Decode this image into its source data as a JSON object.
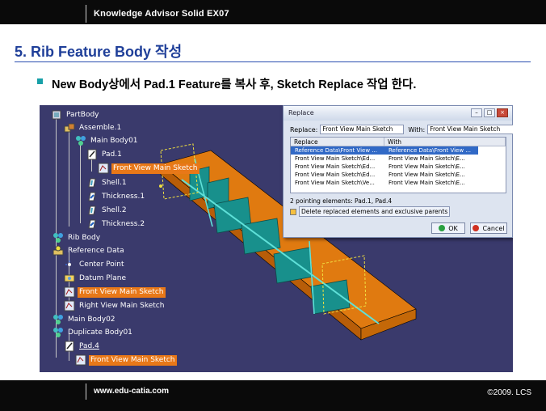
{
  "header": {
    "course": "Knowledge Advisor Solid EX07"
  },
  "slide": {
    "title": "5. Rib Feature Body 작성",
    "bullet": "New Body상에서 Pad.1 Feature를 복사 후,  Sketch Replace 작업 한다."
  },
  "tree": {
    "items": [
      {
        "label": "PartBody",
        "icon": "partbody-icon"
      },
      {
        "label": "Assemble.1",
        "icon": "assemble-icon"
      },
      {
        "label": "Main Body01",
        "icon": "body-icon"
      },
      {
        "label": "Pad.1",
        "icon": "pad-icon"
      },
      {
        "label": "Front View Main Sketch",
        "icon": "sketch-icon"
      },
      {
        "label": "Shell.1",
        "icon": "shell-icon"
      },
      {
        "label": "Thickness.1",
        "icon": "thickness-icon"
      },
      {
        "label": "Shell.2",
        "icon": "shell-icon"
      },
      {
        "label": "Thickness.2",
        "icon": "thickness-icon"
      },
      {
        "label": "Rib Body",
        "icon": "body-icon"
      },
      {
        "label": "Reference Data",
        "icon": "geoset-icon"
      },
      {
        "label": "Center Point",
        "icon": "point-icon"
      },
      {
        "label": "Datum Plane",
        "icon": "plane-icon"
      },
      {
        "label": "Front View Main Sketch",
        "icon": "sketch-icon"
      },
      {
        "label": "Right View Main Sketch",
        "icon": "sketch-icon"
      },
      {
        "label": "Main Body02",
        "icon": "body-icon"
      },
      {
        "label": "Duplicate Body01",
        "icon": "body-icon"
      },
      {
        "label": "Pad.4",
        "icon": "pad-icon"
      },
      {
        "label": "Front View Main Sketch",
        "icon": "sketch-icon"
      }
    ]
  },
  "dialog": {
    "title": "Replace",
    "replace_label": "Replace:",
    "replace_value": "Front View Main Sketch",
    "with_label": "With:",
    "with_value": "Front View Main Sketch",
    "columns": [
      "Replace",
      "With"
    ],
    "rows": [
      [
        "Reference Data\\Front View ...",
        "Reference Data\\Front View ..."
      ],
      [
        "Front View Main Sketch\\Ed...",
        "Front View Main Sketch\\E..."
      ],
      [
        "Front View Main Sketch\\Ed...",
        "Front View Main Sketch\\E..."
      ],
      [
        "Front View Main Sketch\\Ed...",
        "Front View Main Sketch\\E..."
      ],
      [
        "Front View Main Sketch\\Ve...",
        "Front View Main Sketch\\E..."
      ]
    ],
    "status": "2 pointing elements: Pad.1, Pad.4",
    "checkbox_label": "Delete replaced elements and exclusive parents",
    "ok_label": "OK",
    "cancel_label": "Cancel"
  },
  "footer": {
    "url": "www.edu-catia.com",
    "copyright": "©2009. LCS"
  },
  "colors": {
    "title_blue": "#1f3f99",
    "viewport_bg": "#3a3a6c",
    "highlight_orange": "#e87818",
    "part_orange": "#e07a10",
    "part_teal": "#18908c",
    "dialog_selection": "#3169c6"
  }
}
